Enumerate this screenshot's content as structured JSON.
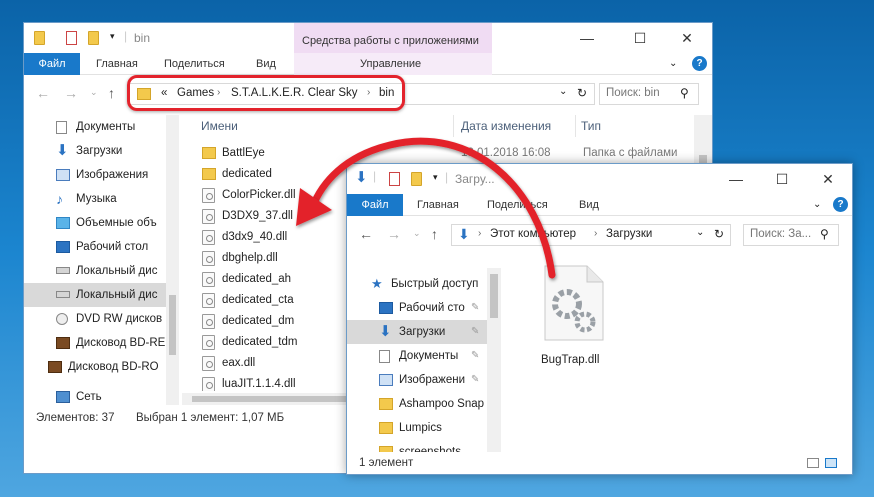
{
  "back": {
    "title": "bin",
    "context_tab": "Средства работы с приложениями",
    "ribbon": {
      "file": "Файл",
      "home": "Главная",
      "share": "Поделиться",
      "view": "Вид",
      "manage": "Управление"
    },
    "address": {
      "crumbs": [
        "«",
        "Games",
        "S.T.A.L.K.E.R. Clear Sky",
        "bin"
      ]
    },
    "search": {
      "placeholder": "Поиск: bin"
    },
    "sidebar": [
      "Документы",
      "Загрузки",
      "Изображения",
      "Музыка",
      "Объемные объ",
      "Рабочий стол",
      "Локальный дис",
      "Локальный дис",
      "DVD RW дисков",
      "Дисковод BD-RE",
      "Дисковод BD-RO",
      "Сеть"
    ],
    "columns": {
      "name": "Имени",
      "date": "Дата изменения",
      "type": "Тип"
    },
    "files": [
      "BattlEye",
      "dedicated",
      "ColorPicker.dll",
      "D3DX9_37.dll",
      "d3dx9_40.dll",
      "dbghelp.dll",
      "dedicated_ah",
      "dedicated_cta",
      "dedicated_dm",
      "dedicated_tdm",
      "eax.dll",
      "luaJIT.1.1.4.dll"
    ],
    "first_row": {
      "date": "13.01.2018 16:08",
      "type": "Папка с файлами"
    },
    "status": {
      "count": "Элементов: 37",
      "selected": "Выбран 1 элемент: 1,07 МБ"
    }
  },
  "front": {
    "title": "Загру...",
    "ribbon": {
      "file": "Файл",
      "home": "Главная",
      "share": "Поделиться",
      "view": "Вид"
    },
    "address": {
      "crumbs": [
        "Этот компьютер",
        "Загрузки"
      ]
    },
    "search": {
      "placeholder": "Поиск: За..."
    },
    "sidebar": [
      "Быстрый доступ",
      "Рабочий сто",
      "Загрузки",
      "Документы",
      "Изображени",
      "Ashampoo Snap",
      "Lumpics",
      "screenshots"
    ],
    "file": {
      "name": "BugTrap.dll"
    },
    "status": {
      "count": "1 элемент"
    }
  },
  "colors": {
    "highlight": "#e3232c",
    "arrow": "#e3232c",
    "accent": "#1979ca"
  }
}
